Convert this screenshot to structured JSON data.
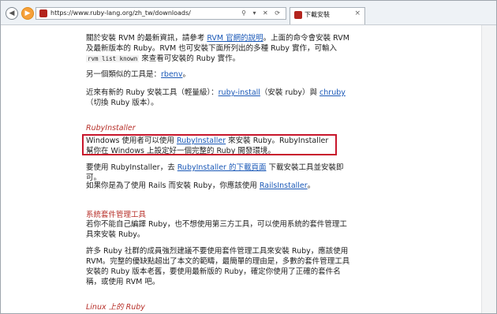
{
  "browser": {
    "url": "https://www.ruby-lang.org/zh_tw/downloads/",
    "address_icons": "⚲ ▾ ✕ ⟳",
    "tab_title": "下載安裝",
    "tab_close": "×",
    "back_glyph": "◀",
    "forward_glyph": "▶"
  },
  "page": {
    "rvm_para": {
      "t1": "關於安裝 RVM 的最新資訊，請參考 ",
      "link": "RVM 官網的說明",
      "t2": "。上面的命令會安裝 RVM 及最新版本的 Ruby。RVM 也可安裝下面所列出的多種 Ruby 實作，可輸入 ",
      "code": "rvm list known",
      "t3": " 來查看可安裝的 Ruby 實作。"
    },
    "rbenv_para": {
      "t1": "另一個類似的工具是：",
      "link": "rbenv",
      "t2": "。"
    },
    "ruby_install_para": {
      "t1": "近來有新的 Ruby 安裝工具（輕量級）：",
      "link1": "ruby-install",
      "t2": "（安裝 ruby）與 ",
      "link2": "chruby",
      "t3": "（切換 Ruby 版本）。"
    },
    "rubyinstaller_heading": "RubyInstaller",
    "rubyinstaller_para": {
      "t1": "Windows 使用者可以使用 ",
      "link": "RubyInstaller",
      "t2": " 來安裝 Ruby。RubyInstaller 幫你在 Windows 上設定好一個完整的 Ruby 開發環境。"
    },
    "download_para": {
      "t1": "要使用 RubyInstaller，去 ",
      "link": "RubyInstaller 的下載頁面",
      "t2": " 下載安裝工具並安裝即可。"
    },
    "rails_para": {
      "t1": "如果你是為了使用 Rails 而安裝 Ruby，你應該使用 ",
      "link": "RailsInstaller",
      "t2": "。"
    },
    "pkg_heading": "系統套件管理工具",
    "pkg_para1": "若你不能自己編譯 Ruby，也不想使用第三方工具，可以使用系統的套件管理工具來安裝 Ruby。",
    "pkg_para2": "許多 Ruby 社群的成員強烈建議不要使用套件管理工具來安裝 Ruby，應該使用 RVM。完整的優缺點超出了本文的範疇，最簡單的理由是，多數的套件管理工具安裝的 Ruby 版本老舊，要使用最新版的 Ruby，確定你使用了正確的套件名稱，或使用 RVM 吧。",
    "linux_heading": "Linux 上的 Ruby"
  }
}
